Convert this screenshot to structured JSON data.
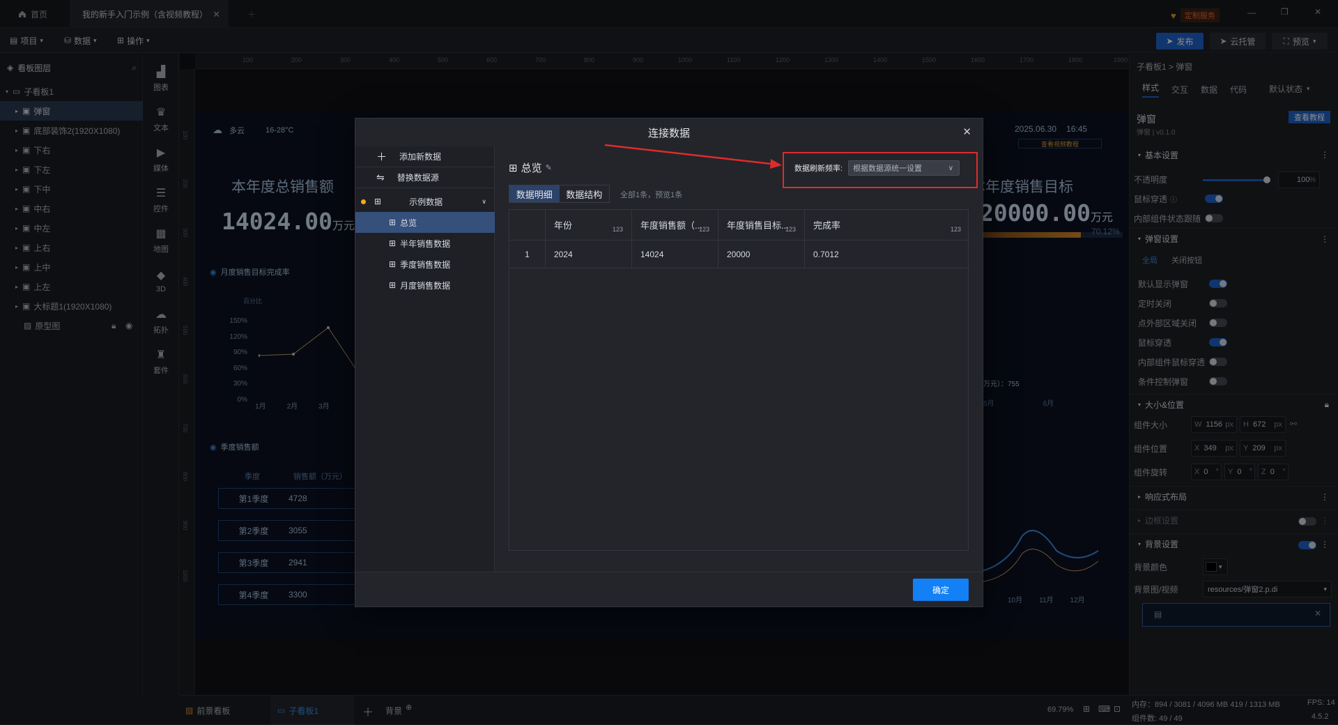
{
  "titlebar": {
    "home_tab": "首页",
    "doc_tab": "我的新手入门示例（含视频教程）",
    "custom_service": "定制服务"
  },
  "menubar": {
    "project": "项目",
    "data": "数据",
    "operate": "操作",
    "publish": "发布",
    "cloud_host": "云托管",
    "preview": "预览"
  },
  "left_panel": {
    "title": "看板图层",
    "layers": [
      {
        "label": "子看板1"
      },
      {
        "label": "弹窗"
      },
      {
        "label": "底部装饰2(1920X1080)"
      },
      {
        "label": "下右"
      },
      {
        "label": "下左"
      },
      {
        "label": "下中"
      },
      {
        "label": "中右"
      },
      {
        "label": "中左"
      },
      {
        "label": "上右"
      },
      {
        "label": "上中"
      },
      {
        "label": "上左"
      },
      {
        "label": "大标题1(1920X1080)"
      },
      {
        "label": "原型图"
      }
    ]
  },
  "iconbar": [
    {
      "label": "图表"
    },
    {
      "label": "文本"
    },
    {
      "label": "媒体"
    },
    {
      "label": "控件"
    },
    {
      "label": "地图"
    },
    {
      "label": "3D"
    },
    {
      "label": "拓扑"
    },
    {
      "label": "套件"
    }
  ],
  "ruler": [
    "100",
    "200",
    "300",
    "400",
    "500",
    "600",
    "700",
    "800",
    "900",
    "1000",
    "1100",
    "1200",
    "1300",
    "1400",
    "1500",
    "1600",
    "1700",
    "1800",
    "1900"
  ],
  "ruler_v": [
    "100",
    "200",
    "300",
    "400",
    "500",
    "600",
    "700",
    "800",
    "900",
    "1000"
  ],
  "board": {
    "weather": "多云",
    "temp": "16-28°C",
    "date": "2025.06.30",
    "time": "16:45",
    "video_link": "查看视频教程",
    "total_title": "本年度总销售额",
    "total_value": "14024.00",
    "unit": "万元",
    "target_title": "本年度销售目标",
    "target_value": "20000.00",
    "target_percent": "70.12%",
    "monthly_title": "月度销售目标完成率",
    "monthly_legend": "百分比",
    "monthly_y": [
      "150%",
      "120%",
      "90%",
      "60%",
      "30%",
      "0%"
    ],
    "monthly_x": [
      "1月",
      "2月",
      "3月"
    ],
    "right_x": [
      "5月",
      "6月"
    ],
    "tooltip": "万元）：755",
    "lower_x": [
      "10月",
      "11月",
      "12月"
    ],
    "quarter_title": "季度销售额",
    "quarter_header_q": "季度",
    "quarter_header_v": "销售额（万元）",
    "quarters": [
      {
        "q": "第1季度",
        "v": "4728"
      },
      {
        "q": "第2季度",
        "v": "3055"
      },
      {
        "q": "第3季度",
        "v": "2941"
      },
      {
        "q": "第4季度",
        "v": "3300"
      }
    ]
  },
  "modal": {
    "title": "连接数据",
    "add_data": "添加新数据",
    "replace_source": "替换数据源",
    "example_data": "示例数据",
    "datasets": [
      "总览",
      "半年销售数据",
      "季度销售数据",
      "月度销售数据"
    ],
    "current": "总览",
    "tab_detail": "数据明细",
    "tab_struct": "数据结构",
    "count_text": "全部1条，预览1条",
    "refresh_label": "数据刷新频率:",
    "refresh_value": "根据数据源统一设置",
    "columns": [
      "",
      "年份",
      "年度销售额（...",
      "年度销售目标...",
      "完成率"
    ],
    "type_badge": "123",
    "rows": [
      [
        "1",
        "2024",
        "14024",
        "20000",
        "0.7012"
      ]
    ],
    "ok": "确定"
  },
  "right_panel": {
    "breadcrumb": "子看板1 > 弹窗",
    "tabs": [
      "样式",
      "交互",
      "数据",
      "代码"
    ],
    "state": "默认状态",
    "name": "弹窗",
    "version": "弹窗 | v0.1.0",
    "tutorial": "查看教程",
    "basic": "基本设置",
    "opacity": "不透明度",
    "opacity_value": "100",
    "opacity_unit": "%",
    "opacity_fraction": 1.0,
    "mouse_through": "鼠标穿透",
    "inner_follow": "内部组件状态跟随",
    "popup_settings": "弹窗设置",
    "sub_all": "全局",
    "sub_close": "关闭按钮",
    "default_show": "默认显示弹窗",
    "timed_close": "定时关闭",
    "outside_close": "点外部区域关闭",
    "mouse_pass": "鼠标穿透",
    "inner_mouse": "内部组件鼠标穿透",
    "cond_ctrl": "条件控制弹窗",
    "size_pos": "大小&位置",
    "comp_size": "组件大小",
    "w": "1156",
    "h": "672",
    "comp_pos": "组件位置",
    "x": "349",
    "y": "209",
    "comp_rot": "组件旋转",
    "rx": "0",
    "ry": "0",
    "rz": "0",
    "px": "px",
    "deg": "°",
    "responsive": "响应式布局",
    "border": "边框设置",
    "bg": "背景设置",
    "bg_color": "背景颜色",
    "bg_color_value": "#000000",
    "bg_media": "背景图/视频",
    "bg_media_value": "resources/弹窗2.p.di"
  },
  "bottombar": {
    "front_board": "前景看板",
    "sub_board": "子看板1",
    "background": "背景",
    "zoom": "69.79%"
  },
  "status": {
    "memory": "内存：894 / 3081 / 4096 MB  419 / 1313 MB",
    "fps": "FPS: 14",
    "components": "组件数: 49 / 49",
    "version": "4.5.2"
  }
}
